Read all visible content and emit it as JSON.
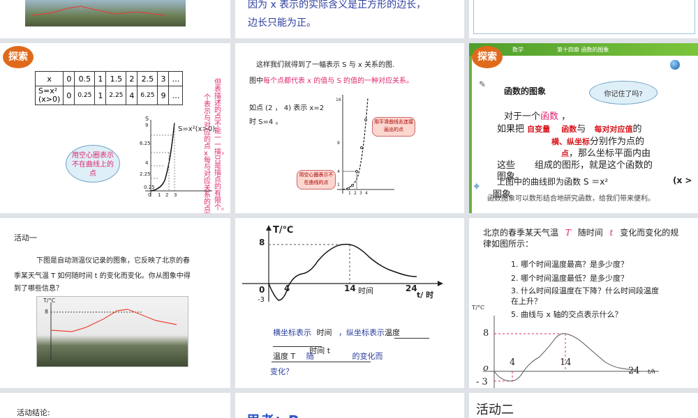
{
  "s1": {
    "line1": "因为 x 表示的实际含义是正方形的边长，",
    "line2": "边长只能为正。"
  },
  "s2": {
    "badge": "探索",
    "table": {
      "r1": [
        "x",
        "0",
        "0.5",
        "1",
        "1.5",
        "2",
        "2.5",
        "3",
        "…"
      ],
      "r2_head": "S=x²\n(x>0)",
      "r2": [
        "0",
        "0.25",
        "1",
        "2.25",
        "4",
        "6.25",
        "9",
        "…"
      ]
    },
    "bubble": "用空心圈表示不在曲线上的点",
    "curve_label": "S=x²(x>0)",
    "y_ticks": [
      "9",
      "6.25",
      "4",
      "2.25",
      "0.25"
    ],
    "y_label": "S",
    "x_ticks": [
      "0",
      "1",
      "2",
      "3"
    ],
    "vtext1": "个表示与对应的点 x 每与对应关系的点有无数",
    "vtext2": "但表描述的点不能一一描，只是描点的有限个。"
  },
  "s3": {
    "line1": "这样我们就得到了一幅表示 S 与 x 关系的图.",
    "line2_a": "图中",
    "line2_b": "每个点都代表 x 的值与 S 的值的一种对应关系。",
    "line3": "如点 (2 ， 4) 表示 x=2",
    "line4": "时 S=4 。",
    "callout1": "用平滑曲线去连接画出的点",
    "callout2": "用空心圈表示不在曲线的点",
    "y_ticks": [
      "16",
      "9",
      "4",
      "1"
    ],
    "x_ticks": [
      "1",
      "2",
      "3",
      "4"
    ]
  },
  "s4": {
    "badge": "探索",
    "header_a": "数学",
    "header_b": "第十四章  函数的图象",
    "title": "函数的图象",
    "bubble": "你记住了吗?",
    "p1": "对于一个",
    "p1b": "函数",
    "p2": "如果把",
    "p2b": "自变量",
    "p2c": "函数",
    "p2d": "与",
    "p2e": "每对对应值",
    "p2f": "的",
    "p3a": "横、纵坐标",
    "p3b": "分别作为点的",
    "p4a": "点",
    "p4b": "，那么坐标平面内由",
    "p5a": "这些",
    "p5b": "组成的图形，就是这个函数的",
    "p6": "图象。",
    "p7": "上图中的曲线即为函数  S ＝x²",
    "p7b": "(x >",
    "p8": "图象",
    "footer": "函数图象可以数形结合地研究函数，给我们带来便利。"
  },
  "s5": {
    "heading": "活动一",
    "p1": "下图是自动测温仪记录的图象，它反映了北京的春",
    "p2": "季某天气温 T 如何随时间 t 的变化而变化。你从图象中得",
    "p3": "到了哪些信息？",
    "photo_y_label": "T/°C",
    "photo_y_tick": "8"
  },
  "s6": {
    "y_label": "T/℃",
    "y8": "8",
    "origin": "0",
    "neg3": "-3",
    "x4": "4",
    "x14": "14",
    "x_time": "时间",
    "x24": "24",
    "x_unit": "t/ 时",
    "q1a": "横坐标表示",
    "q1b": "时间",
    "q1c": "，纵坐标表示",
    "q1d": "温度",
    "q2a": "温度 T",
    "q2b": "随",
    "q2c": "时间 t",
    "q2d": "的变化而",
    "q3": "变化？"
  },
  "s7": {
    "intro_a": "北京的春季某天气温",
    "intro_T": "T",
    "intro_b": "随时间",
    "intro_t": "t",
    "intro_c": "变化而变化的规",
    "intro_d": "律如图所示：",
    "q1": "1. 哪个时间温度最高？是多少度？",
    "q2": "2. 哪个时间温度最低？是多少度？",
    "q3": "3. 什么时间段温度在下降？什么时间段温度",
    "q3b": "在上升？",
    "q5": "5. 曲线与 x 轴的交点表示什么？",
    "y_label": "T/°C",
    "y8": "8",
    "o": "o",
    "neg3": "- 3",
    "x4": "4",
    "x14": "14",
    "x24": "24",
    "x_unit": "t/h"
  },
  "s8": {
    "heading": "活动结论:"
  },
  "s9": {
    "heading": "思考：P"
  },
  "s10": {
    "heading": "活动二"
  }
}
